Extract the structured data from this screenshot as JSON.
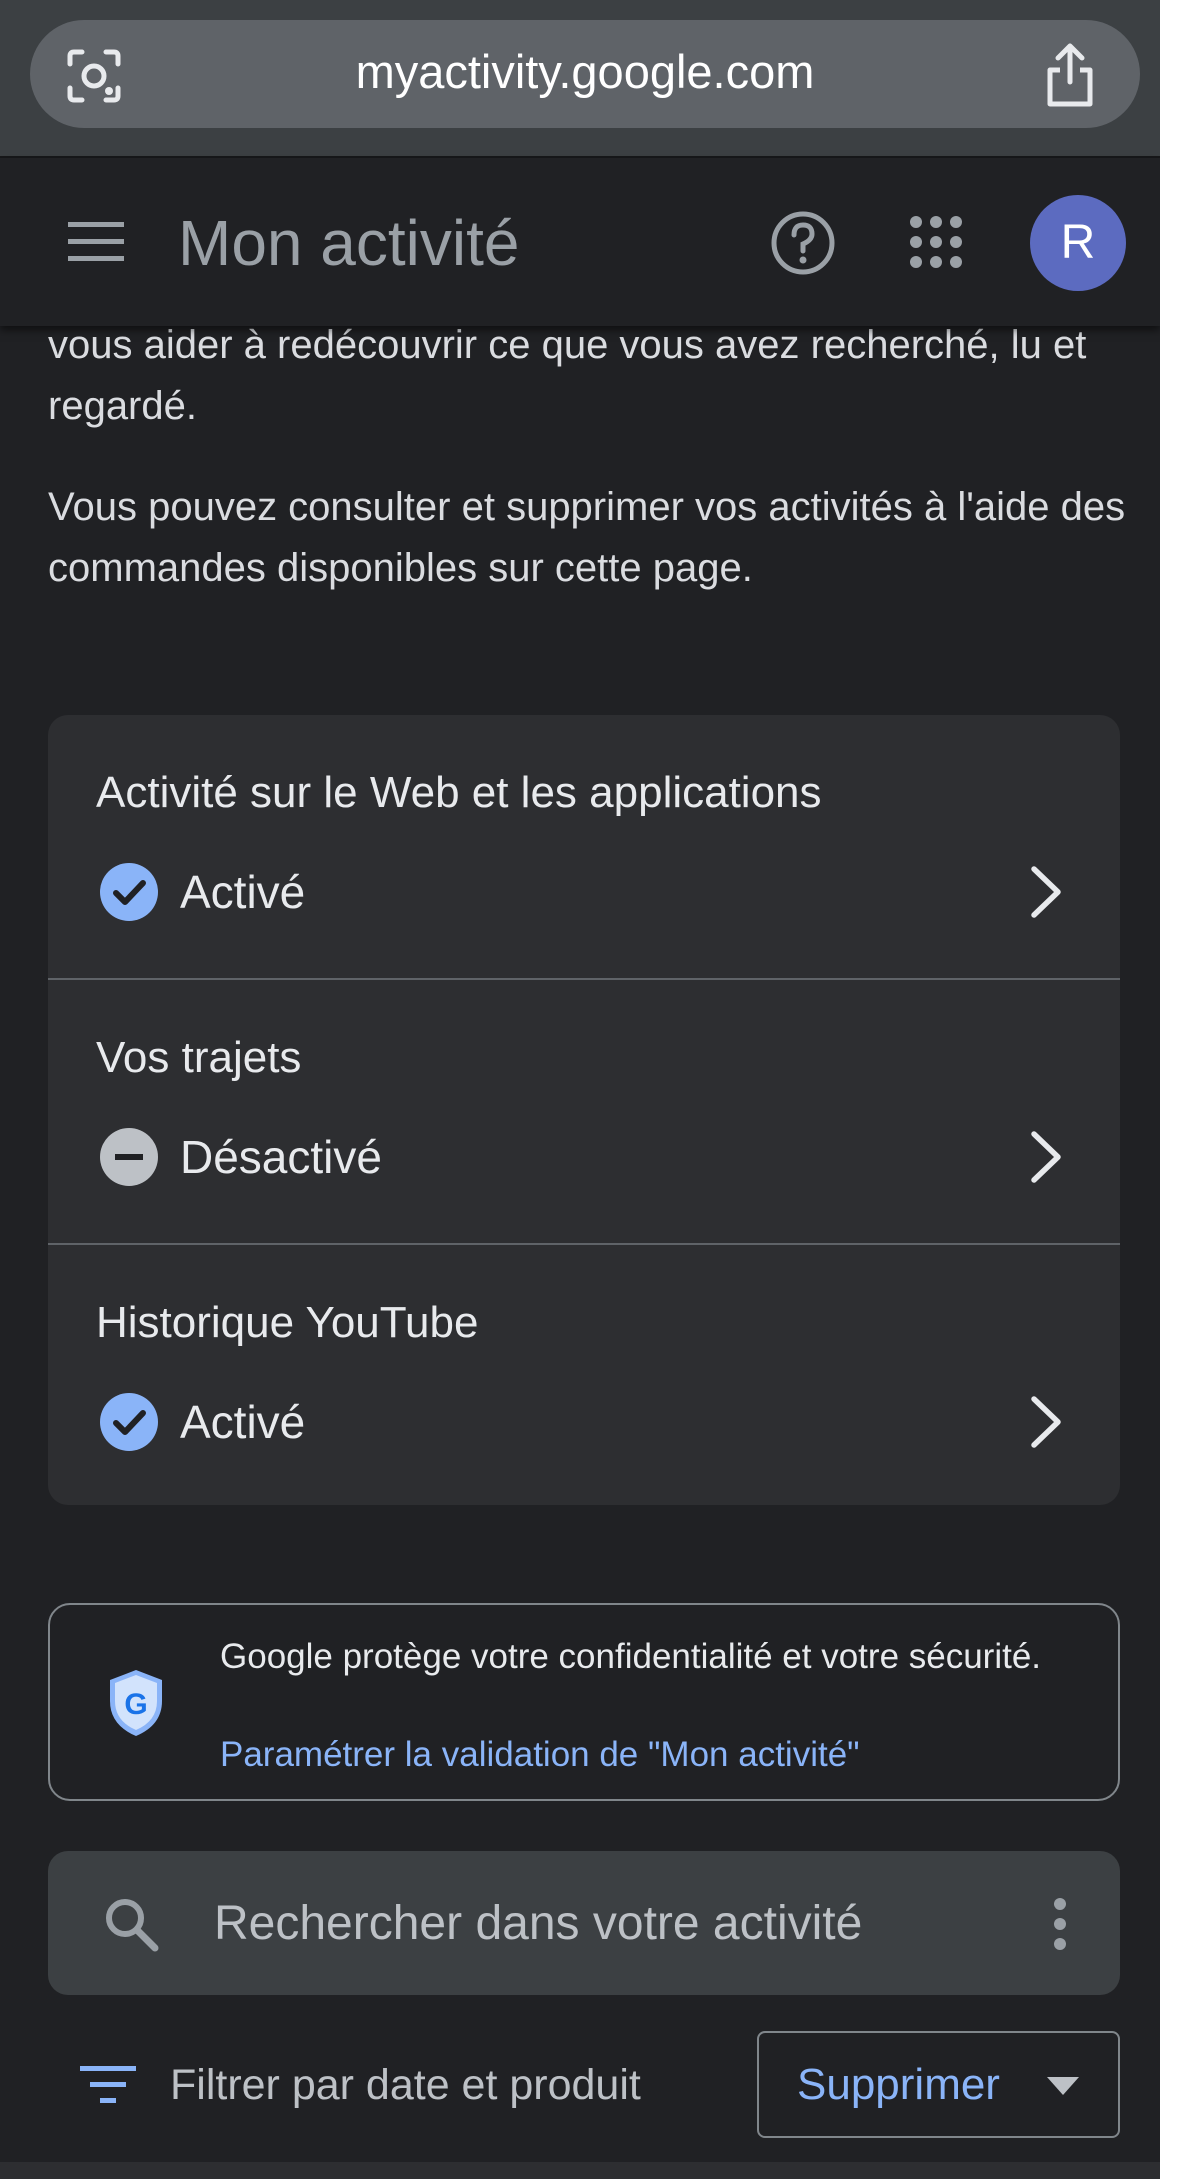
{
  "browser": {
    "url": "myactivity.google.com"
  },
  "header": {
    "title": "Mon activité",
    "avatar_initial": "R"
  },
  "intro": {
    "paragraph_1": "vous aider à redécouvrir ce que vous avez recherché, lu et regardé.",
    "paragraph_2": "Vous pouvez consulter et supprimer vos activités à l'aide des commandes disponibles sur cette page."
  },
  "controls": [
    {
      "title": "Activité sur le Web et les applications",
      "status": "Activé",
      "enabled": true
    },
    {
      "title": "Vos trajets",
      "status": "Désactivé",
      "enabled": false
    },
    {
      "title": "Historique YouTube",
      "status": "Activé",
      "enabled": true
    }
  ],
  "privacy": {
    "text": "Google protège votre confidentialité et votre sécurité.",
    "link": "Paramétrer la validation de \"Mon activité\""
  },
  "search": {
    "placeholder": "Rechercher dans votre activité"
  },
  "filter": {
    "label": "Filtrer par date et produit"
  },
  "delete": {
    "label": "Supprimer"
  },
  "colors": {
    "background": "#202124",
    "card": "#2d2e31",
    "accent_blue": "#8ab4f8",
    "avatar": "#5c6bc0",
    "enabled_check": "#8ab4f8",
    "disabled_icon": "#bdc1c6"
  },
  "icons": {
    "lens": "lens-icon",
    "share": "share-icon",
    "menu": "menu-icon",
    "help": "help-icon",
    "apps": "apps-grid-icon",
    "check": "check-circle-icon",
    "disabled": "minus-circle-icon",
    "chevron": "chevron-right-icon",
    "shield": "shield-g-icon",
    "search": "search-icon",
    "more": "more-vertical-icon",
    "filter": "filter-icon",
    "dropdown": "dropdown-arrow-icon"
  }
}
